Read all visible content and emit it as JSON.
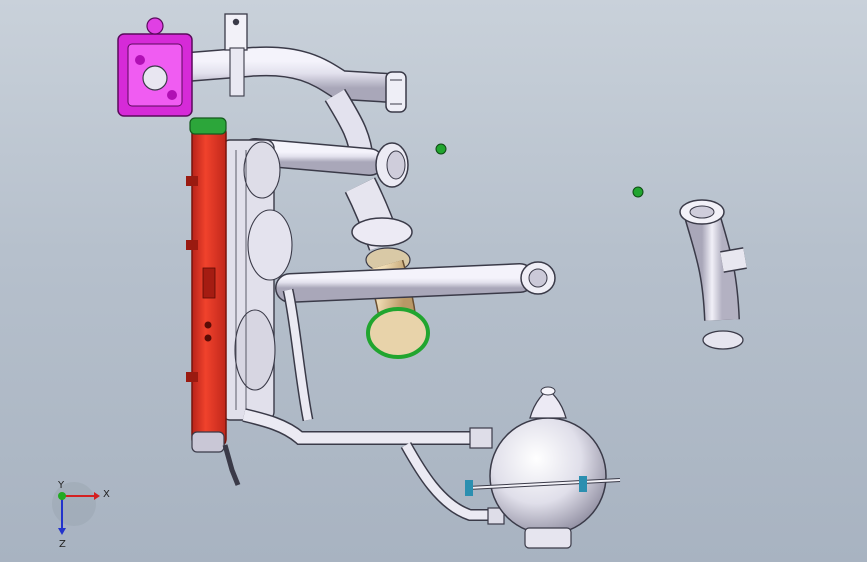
{
  "viewport": {
    "background_top": "#c9d1da",
    "background_bottom": "#a8b3c1"
  },
  "colors": {
    "tube": "#e4e3ee",
    "tube_shadow": "#9c9aac",
    "outline": "#3a3a48",
    "radiator": "#e8321e",
    "radiator_dark": "#9a1a10",
    "bracket": "#d31cd6",
    "clamp_green": "#21a52f",
    "hose_tan": "#dcc39a",
    "axis_x": "#d42020",
    "axis_y": "#22aa22",
    "axis_z": "#2233cc"
  },
  "triad": {
    "x_label": "X",
    "y_label": "Y",
    "z_label": "Z"
  },
  "components": [
    "upper-hose",
    "radiator",
    "fan-shroud",
    "lower-pipe",
    "expansion-tank",
    "separate-hose"
  ]
}
